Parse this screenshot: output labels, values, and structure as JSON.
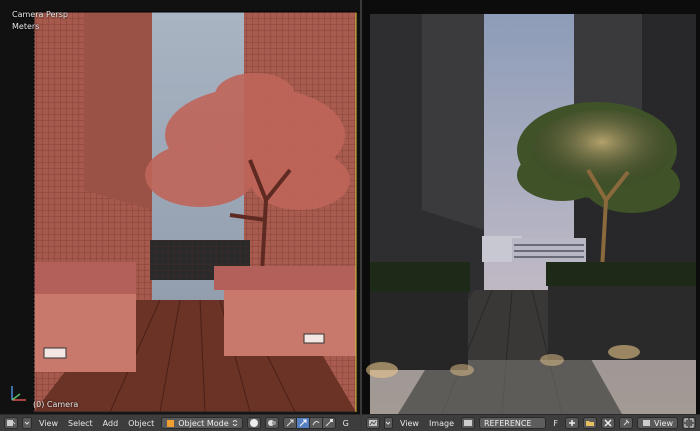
{
  "viewport": {
    "view_name": "Camera Persp",
    "units": "Meters",
    "object_label": "(0) Camera",
    "header": {
      "menus": [
        "View",
        "Select",
        "Add",
        "Object"
      ],
      "mode": "Object Mode",
      "truncated_char": "G"
    }
  },
  "image_editor": {
    "header": {
      "menus": [
        "View",
        "Image"
      ],
      "image_name": "REFERENCE",
      "fake_user_label": "F",
      "view_label": "View"
    }
  },
  "colors": {
    "header_bg": "#3d3d3d",
    "button_bg": "#5a5a5a",
    "active": "#5680c2",
    "wire_tint": "#b0584b"
  }
}
